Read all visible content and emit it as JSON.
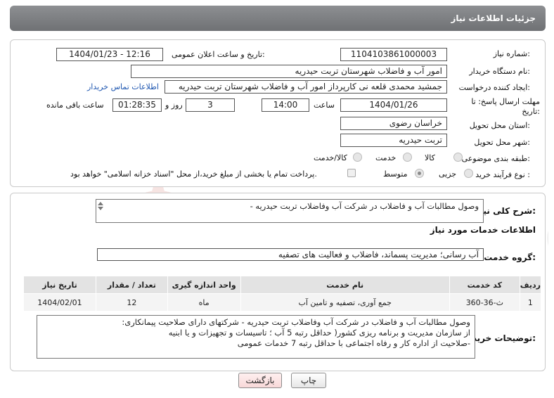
{
  "header": {
    "title": "جزئیات اطلاعات نیاز"
  },
  "need_number": {
    "label": "شماره نیاز:",
    "value": "1104103861000003"
  },
  "announce": {
    "label": "تاریخ و ساعت اعلان عمومی:",
    "value": "1404/01/23 - 12:16"
  },
  "buyer_org": {
    "label": "نام دستگاه خریدار:",
    "value": "امور آب و فاضلاب شهرستان تربت حیدریه"
  },
  "requester": {
    "label": "ایجاد کننده درخواست:",
    "value": "جمشید محمدی قلعه نی کارپرداز امور آب و فاضلاب شهرستان تربت حیدریه",
    "contact_link": "اطلاعات تماس خریدار"
  },
  "deadline": {
    "label": "مهلت ارسال پاسخ: تا تاریخ:",
    "date": "1404/01/26",
    "time_label": "ساعت",
    "time": "14:00",
    "days": "3",
    "days_label": "روز و",
    "remaining": "01:28:35",
    "remaining_label": "ساعت باقی مانده"
  },
  "province": {
    "label": "استان محل تحویل:",
    "value": "خراسان رضوی"
  },
  "city": {
    "label": "شهر محل تحویل:",
    "value": "تربت حیدریه"
  },
  "category": {
    "label": "طبقه بندی موضوعی:",
    "options": [
      "کالا",
      "خدمت",
      "کالا/خدمت"
    ]
  },
  "process": {
    "label": "نوع فرآیند خرید :",
    "options": [
      "جزیی",
      "متوسط"
    ],
    "payment_note": "پرداخت تمام یا بخشی از مبلغ خرید،از محل \"اسناد خزانه اسلامی\" خواهد بود."
  },
  "summary": {
    "label": "شرح کلی نیاز:",
    "value": "وصول مطالبات آب و فاضلاب در شرکت آب وفاضلاب تربت حیدریه -"
  },
  "services": {
    "section_title": "اطلاعات خدمات مورد نیاز",
    "group_label": "گروه خدمت:",
    "group_value": "آب رسانی؛ مدیریت پسماند، فاضلاب و فعالیت های تصفیه",
    "columns": [
      "ردیف",
      "کد خدمت",
      "نام خدمت",
      "واحد اندازه گیری",
      "تعداد / مقدار",
      "تاریخ نیاز"
    ],
    "rows": [
      [
        "1",
        "ث-36-360",
        "جمع آوری، تصفیه و تامین آب",
        "ماه",
        "12",
        "1404/02/01"
      ]
    ]
  },
  "buyer_notes": {
    "label": "توضیحات خریدار:",
    "lines": [
      "وصول مطالبات آب و فاضلاب در شرکت آب وفاضلاب تربت حیدریه - شرکتهای دارای صلاحیت پیمانکاری:",
      "از سازمان مدیریت و برنامه ریزی کشور( حداقل رتبه 5 آب ؛ تاسیسات و تجهیزات و یا ابنیه",
      "-صلاحیت از اداره کار و رفاه اجتماعی با حداقل رتبه 7 خدمات عمومی"
    ]
  },
  "buttons": {
    "print": "چاپ",
    "back": "بازگشت"
  },
  "watermark": {
    "text": "AriaTender.neT"
  }
}
